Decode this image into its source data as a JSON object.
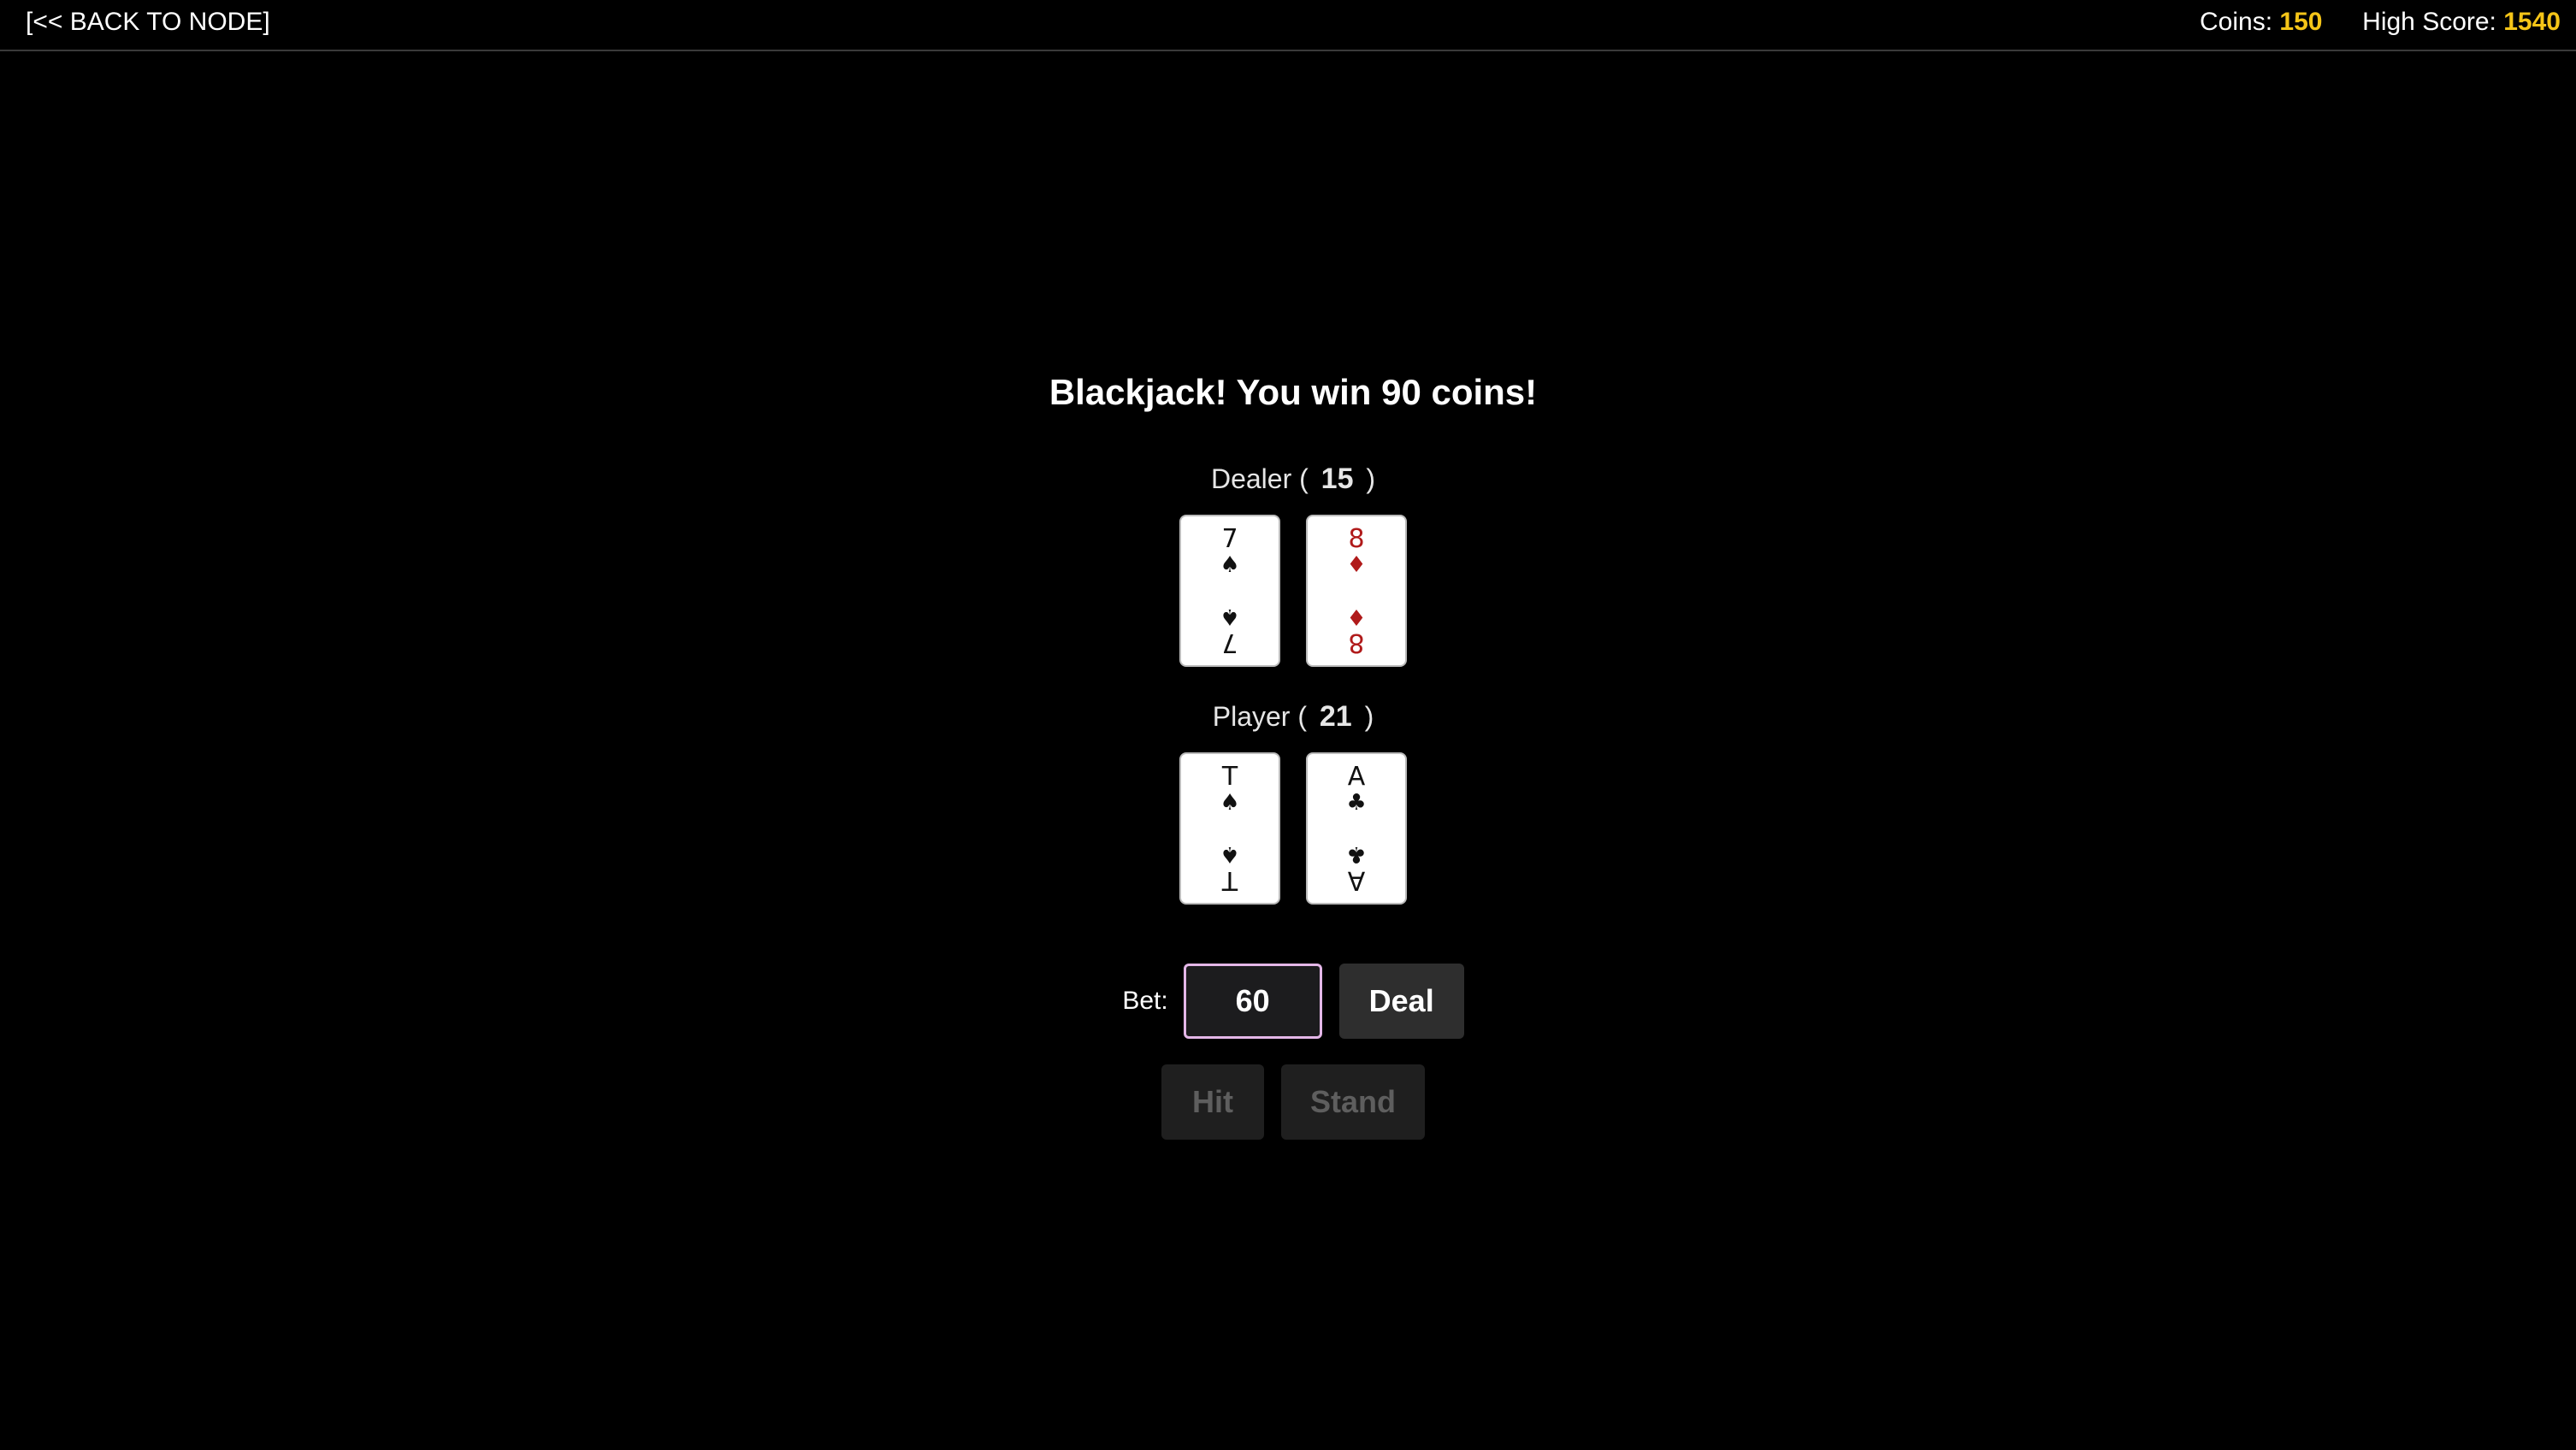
{
  "header": {
    "back_label": "[<< BACK TO NODE]",
    "coins_label": "Coins:",
    "coins_value": "150",
    "high_score_label": "High Score:",
    "high_score_value": "1540"
  },
  "game": {
    "message": "Blackjack! You win 90 coins!",
    "dealer": {
      "label": "Dealer (",
      "score": "15",
      "close": ")",
      "cards": [
        {
          "rank": "7",
          "suit": "♠",
          "suit_name": "spades",
          "color": "black"
        },
        {
          "rank": "8",
          "suit": "♦",
          "suit_name": "diamonds",
          "color": "red"
        }
      ]
    },
    "player": {
      "label": "Player (",
      "score": "21",
      "close": ")",
      "cards": [
        {
          "rank": "T",
          "suit": "♠",
          "suit_name": "spades",
          "color": "black"
        },
        {
          "rank": "A",
          "suit": "♣",
          "suit_name": "clubs",
          "color": "black"
        }
      ]
    },
    "bet": {
      "label": "Bet:",
      "value": "60"
    },
    "buttons": {
      "deal": "Deal",
      "hit": "Hit",
      "stand": "Stand"
    }
  },
  "colors": {
    "background": "#000000",
    "accent": "#f5c518",
    "card_red": "#b01a1a",
    "input_border": "#e4b7e8"
  }
}
